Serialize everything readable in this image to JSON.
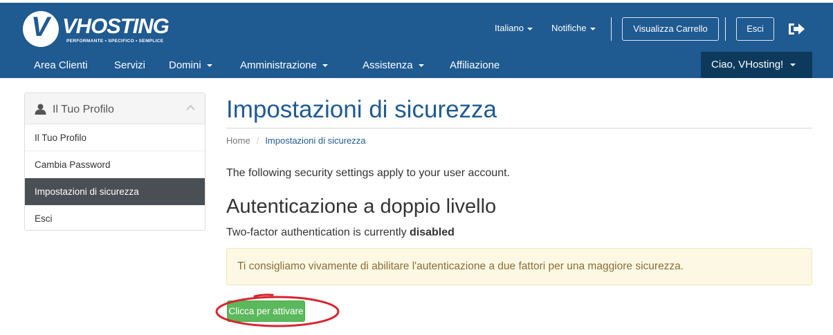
{
  "brand": {
    "logo_letter": "V",
    "name": "VHOSTING",
    "tagline": "PERFORMANTE • SPECIFICO • SEMPLICE"
  },
  "topbar": {
    "language": "Italiano",
    "notifications": "Notifiche",
    "view_cart": "Visualizza Carrello",
    "logout": "Esci"
  },
  "nav": {
    "items": [
      {
        "label": "Area Clienti",
        "dropdown": false
      },
      {
        "label": "Servizi",
        "dropdown": false
      },
      {
        "label": "Domini",
        "dropdown": true
      },
      {
        "label": "Amministrazione",
        "dropdown": true
      },
      {
        "label": "Assistenza",
        "dropdown": true
      },
      {
        "label": "Affiliazione",
        "dropdown": false
      }
    ],
    "user_greeting": "Ciao, VHosting!"
  },
  "sidebar": {
    "title": "Il Tuo Profilo",
    "items": [
      {
        "label": "Il Tuo Profilo",
        "active": false
      },
      {
        "label": "Cambia Password",
        "active": false
      },
      {
        "label": "Impostazioni di sicurezza",
        "active": true
      },
      {
        "label": "Esci",
        "active": false
      }
    ]
  },
  "main": {
    "title": "Impostazioni di sicurezza",
    "breadcrumb": {
      "home": "Home",
      "current": "Impostazioni di sicurezza"
    },
    "intro": "The following security settings apply to your user account.",
    "section_title": "Autenticazione a doppio livello",
    "status_prefix": "Two-factor authentication is currently",
    "status_value": "disabled",
    "alert": "Ti consigliamo vivamente di abilitare l'autenticazione a due fattori per una maggiore sicurezza.",
    "activate_button": "Clicca per attivare"
  },
  "colors": {
    "primary": "#1f5a91",
    "nav_dark": "#0d3a5c",
    "sidebar_active": "#4a4f55",
    "success": "#5cb85c",
    "warning_bg": "#fcf8e3",
    "warning_text": "#8a6d3b",
    "annotation": "#d9232e"
  },
  "icons": {
    "user": "user-icon",
    "chevron_up": "chevron-up-icon",
    "logout": "logout-icon",
    "caret": "caret-down-icon"
  }
}
